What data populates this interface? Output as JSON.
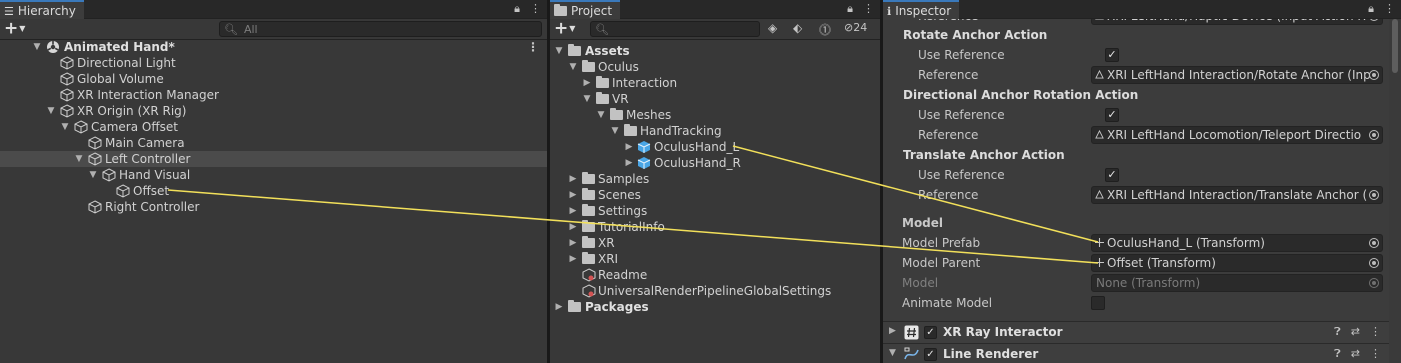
{
  "hierarchy": {
    "tab_label": "Hierarchy",
    "search_placeholder": "All",
    "items": [
      {
        "label": "Animated Hand*",
        "icon": "unity-scene-icon",
        "bold": true
      },
      {
        "label": "Directional Light",
        "icon": "cube-icon"
      },
      {
        "label": "Global Volume",
        "icon": "cube-icon"
      },
      {
        "label": "XR Interaction Manager",
        "icon": "cube-icon"
      },
      {
        "label": "XR Origin (XR Rig)",
        "icon": "cube-icon"
      },
      {
        "label": "Camera Offset",
        "icon": "cube-icon"
      },
      {
        "label": "Main Camera",
        "icon": "cube-icon"
      },
      {
        "label": "Left Controller",
        "icon": "cube-icon",
        "selected": true
      },
      {
        "label": "Hand Visual",
        "icon": "cube-icon"
      },
      {
        "label": "Offset",
        "icon": "cube-icon"
      },
      {
        "label": "Right Controller",
        "icon": "cube-icon"
      }
    ]
  },
  "project": {
    "tab_label": "Project",
    "hidden_count": "24",
    "items": [
      {
        "label": "Assets",
        "icon": "folder-open-icon",
        "bold": true
      },
      {
        "label": "Oculus",
        "icon": "folder-open-icon"
      },
      {
        "label": "Interaction",
        "icon": "folder-icon"
      },
      {
        "label": "VR",
        "icon": "folder-open-icon"
      },
      {
        "label": "Meshes",
        "icon": "folder-open-icon"
      },
      {
        "label": "HandTracking",
        "icon": "folder-open-icon"
      },
      {
        "label": "OculusHand_L",
        "icon": "prefab-model-icon"
      },
      {
        "label": "OculusHand_R",
        "icon": "prefab-model-icon"
      },
      {
        "label": "Samples",
        "icon": "folder-icon"
      },
      {
        "label": "Scenes",
        "icon": "folder-icon"
      },
      {
        "label": "Settings",
        "icon": "folder-icon"
      },
      {
        "label": "TutorialInfo",
        "icon": "folder-icon"
      },
      {
        "label": "XR",
        "icon": "folder-icon"
      },
      {
        "label": "XRI",
        "icon": "folder-icon"
      },
      {
        "label": "Readme",
        "icon": "settings-asset-icon"
      },
      {
        "label": "UniversalRenderPipelineGlobalSettings",
        "icon": "settings-asset-icon"
      },
      {
        "label": "Packages",
        "icon": "folder-icon",
        "bold": true
      }
    ]
  },
  "inspector": {
    "tab_label": "Inspector",
    "partial_top": {
      "label": "Reference",
      "value": "XRI LeftHand/Haptic Device (Input Action R"
    },
    "sections": [
      {
        "title": "Rotate Anchor Action",
        "use_reference": "Use Reference",
        "reference_label": "Reference",
        "reference_value": "XRI LeftHand Interaction/Rotate Anchor (Inp"
      },
      {
        "title": "Directional Anchor Rotation Action",
        "use_reference": "Use Reference",
        "reference_label": "Reference",
        "reference_value": "XRI LeftHand Locomotion/Teleport Directio"
      },
      {
        "title": "Translate Anchor Action",
        "use_reference": "Use Reference",
        "reference_label": "Reference",
        "reference_value": "XRI LeftHand Interaction/Translate Anchor ("
      }
    ],
    "model": {
      "header": "Model",
      "prefab_label": "Model Prefab",
      "prefab_value": "OculusHand_L (Transform)",
      "parent_label": "Model Parent",
      "parent_value": "Offset (Transform)",
      "model_label": "Model",
      "model_value": "None (Transform)",
      "animate_label": "Animate Model"
    },
    "components": [
      {
        "name": "XR Ray Interactor",
        "icon": "script-hash-icon"
      },
      {
        "name": "Line Renderer",
        "icon": "line-renderer-icon"
      }
    ]
  },
  "colors": {
    "annotation_line": "#f2e05a",
    "selection": "#4b4b4b",
    "tab_accent": "#3a79bb"
  }
}
